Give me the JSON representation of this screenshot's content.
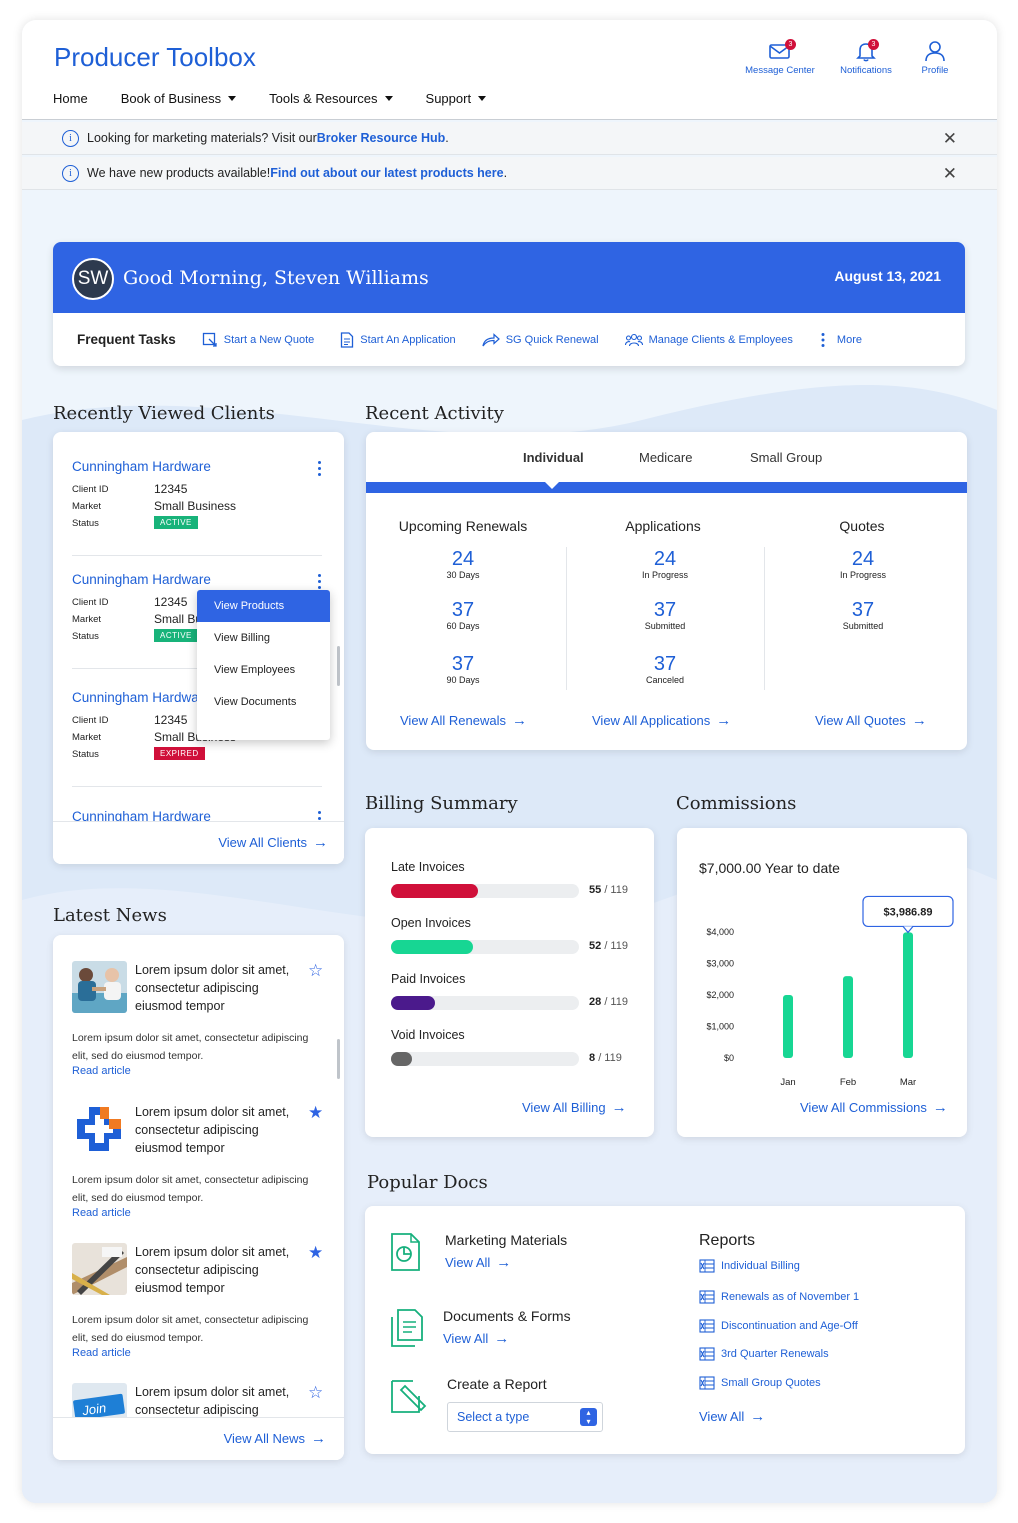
{
  "app": {
    "title": "Producer Toolbox",
    "nav": [
      {
        "label": "Home",
        "has_caret": false
      },
      {
        "label": "Book of Business",
        "has_caret": true
      },
      {
        "label": "Tools & Resources",
        "has_caret": true
      },
      {
        "label": "Support",
        "has_caret": true
      }
    ],
    "header_icons": {
      "message_center": {
        "label": "Message Center",
        "count": "3",
        "icon": "envelope-icon"
      },
      "notifications": {
        "label": "Notifications",
        "count": "3",
        "icon": "bell-icon"
      },
      "profile": {
        "label": "Profile",
        "icon": "user-icon"
      }
    }
  },
  "banners": [
    {
      "text": "Looking for marketing materials? Visit our ",
      "link": "Broker Resource Hub",
      "after": "."
    },
    {
      "text": "We have new products available! ",
      "link": "Find out about our latest products here",
      "after": "."
    }
  ],
  "greeting": {
    "initials": "SW",
    "text": "Good Morning, Steven Williams",
    "date": "August 13, 2021",
    "frequent_tasks_label": "Frequent Tasks",
    "tasks": [
      {
        "label": "Start a New Quote",
        "icon": "quote-icon"
      },
      {
        "label": "Start An Application",
        "icon": "document-icon"
      },
      {
        "label": "SG Quick Renewal",
        "icon": "share-arrow-icon"
      },
      {
        "label": "Manage Clients & Employees",
        "icon": "group-icon"
      },
      {
        "label": "More",
        "icon": "vertical-dots-icon"
      }
    ]
  },
  "recent_clients": {
    "title": "Recently Viewed Clients",
    "labels": {
      "client_id": "Client ID",
      "market": "Market",
      "status": "Status"
    },
    "clients": [
      {
        "name": "Cunningham Hardware",
        "client_id": "12345",
        "market": "Small Business",
        "status": "ACTIVE"
      },
      {
        "name": "Cunningham Hardware",
        "client_id": "12345",
        "market": "Small Business",
        "status": "ACTIVE"
      },
      {
        "name": "Cunningham Hardware",
        "client_id": "12345",
        "market": "Small Business",
        "status": "EXPIRED"
      },
      {
        "name": "Cunningham Hardware"
      }
    ],
    "menu": [
      "View Products",
      "View Billing",
      "View Employees",
      "View Documents"
    ],
    "view_all": "View All Clients"
  },
  "recent_activity": {
    "title": "Recent Activity",
    "tabs": [
      "Individual",
      "Medicare",
      "Small Group"
    ],
    "active_tab": "Individual",
    "columns": [
      {
        "title": "Upcoming Renewals",
        "items": [
          {
            "n": "24",
            "s": "30 Days"
          },
          {
            "n": "37",
            "s": "60 Days"
          },
          {
            "n": "37",
            "s": "90 Days"
          }
        ],
        "link": "View All Renewals"
      },
      {
        "title": "Applications",
        "items": [
          {
            "n": "24",
            "s": "In Progress"
          },
          {
            "n": "37",
            "s": "Submitted"
          },
          {
            "n": "37",
            "s": "Canceled"
          }
        ],
        "link": "View All Applications"
      },
      {
        "title": "Quotes",
        "items": [
          {
            "n": "24",
            "s": "In Progress"
          },
          {
            "n": "37",
            "s": "Submitted"
          }
        ],
        "link": "View All Quotes"
      }
    ]
  },
  "billing": {
    "title": "Billing Summary",
    "rows": [
      {
        "label": "Late Invoices",
        "count": "55",
        "total": "/ 119",
        "fraction": 0.462,
        "color": "#d0103a"
      },
      {
        "label": "Open Invoices",
        "count": "52",
        "total": "/ 119",
        "fraction": 0.437,
        "color": "#17d693"
      },
      {
        "label": "Paid Invoices",
        "count": "28",
        "total": "/ 119",
        "fraction": 0.235,
        "color": "#4b1a8c"
      },
      {
        "label": "Void Invoices",
        "count": "8",
        "total": "/ 119",
        "fraction": 0.067,
        "color": "#666666"
      }
    ],
    "view_all": "View All Billing"
  },
  "commissions": {
    "title": "Commissions",
    "ytd": "$7,000.00 Year to date",
    "tooltip": "$3,986.89",
    "view_all": "View All Commissions"
  },
  "chart_data": {
    "type": "bar",
    "categories": [
      "Jan",
      "Feb",
      "Mar"
    ],
    "values": [
      2000,
      2600,
      3986.89
    ],
    "yticks": [
      "$0",
      "$1,000",
      "$2,000",
      "$3,000",
      "$4,000"
    ],
    "ylim": [
      0,
      4000
    ],
    "color": "#17d693",
    "grid": false
  },
  "news": {
    "title": "Latest News",
    "items": [
      {
        "headline": "Lorem ipsum dolor sit amet, consectetur adipiscing eiusmod tempor",
        "body": "Lorem ipsum dolor sit amet, consectetur adipiscing elit, sed do eiusmod tempor.",
        "read": "Read article",
        "starred": false
      },
      {
        "headline": "Lorem ipsum dolor sit amet, consectetur adipiscing eiusmod tempor",
        "body": "Lorem ipsum dolor sit amet, consectetur adipiscing elit, sed do eiusmod tempor.",
        "read": "Read article",
        "starred": true
      },
      {
        "headline": "Lorem ipsum dolor sit amet, consectetur adipiscing eiusmod tempor",
        "body": "Lorem ipsum dolor sit amet, consectetur adipiscing elit, sed do eiusmod tempor.",
        "read": "Read article",
        "starred": true
      },
      {
        "headline": "Lorem ipsum dolor sit amet, consectetur adipiscing",
        "starred": false,
        "image_text": "Join"
      }
    ],
    "view_all": "View All News"
  },
  "docs": {
    "title": "Popular Docs",
    "marketing": {
      "title": "Marketing Materials",
      "link": "View All"
    },
    "documents": {
      "title": "Documents & Forms",
      "link": "View All"
    },
    "report": {
      "title": "Create a Report",
      "placeholder": "Select a type"
    },
    "reports": {
      "title": "Reports",
      "items": [
        "Individual Billing",
        "Renewals as of November 1",
        "Discontinuation and Age-Off",
        "3rd Quarter Renewals",
        "Small Group Quotes"
      ],
      "link": "View All"
    }
  }
}
